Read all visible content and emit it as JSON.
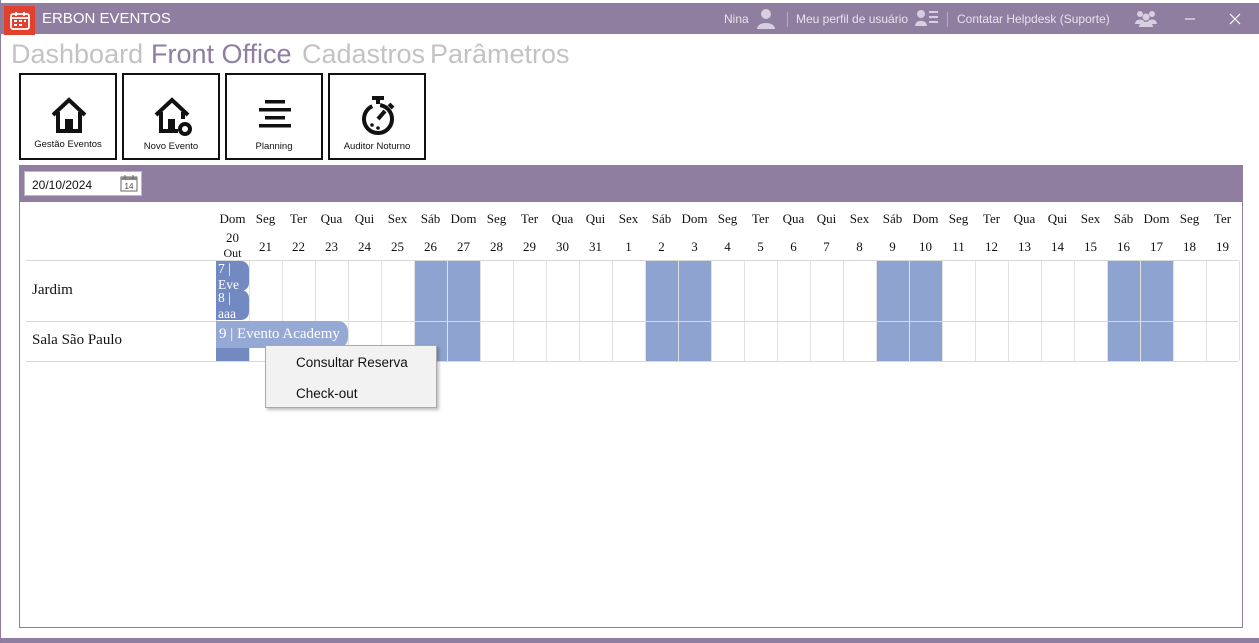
{
  "app": {
    "title": "ERBON EVENTOS"
  },
  "titlebar": {
    "user_name": "Nina",
    "profile_link": "Meu perfil de usuário",
    "helpdesk_link": "Contatar Helpdesk (Suporte)",
    "minimize_label": "—",
    "close_label": "✕"
  },
  "nav": {
    "tabs": [
      {
        "label": "Dashboard",
        "active": false
      },
      {
        "label": "Front Office",
        "active": true
      },
      {
        "label": "Cadastros",
        "active": false
      },
      {
        "label": "Parâmetros",
        "active": false
      }
    ]
  },
  "tiles": [
    {
      "label": "Gestão Eventos",
      "icon": "home-icon"
    },
    {
      "label": "Novo Evento",
      "icon": "home-add-icon"
    },
    {
      "label": "Planning",
      "icon": "align-center-icon"
    },
    {
      "label": "Auditor Noturno",
      "icon": "stopwatch-icon"
    }
  ],
  "toolbar": {
    "date_value": "20/10/2024",
    "calendar_day": "14"
  },
  "planning": {
    "month_label": "Out",
    "days": [
      {
        "dow": "Dom",
        "num": "20"
      },
      {
        "dow": "Seg",
        "num": "21"
      },
      {
        "dow": "Ter",
        "num": "22"
      },
      {
        "dow": "Qua",
        "num": "23"
      },
      {
        "dow": "Qui",
        "num": "24"
      },
      {
        "dow": "Sex",
        "num": "25"
      },
      {
        "dow": "Sáb",
        "num": "26"
      },
      {
        "dow": "Dom",
        "num": "27"
      },
      {
        "dow": "Seg",
        "num": "28"
      },
      {
        "dow": "Ter",
        "num": "29"
      },
      {
        "dow": "Qua",
        "num": "30"
      },
      {
        "dow": "Qui",
        "num": "31"
      },
      {
        "dow": "Sex",
        "num": "1"
      },
      {
        "dow": "Sáb",
        "num": "2"
      },
      {
        "dow": "Dom",
        "num": "3"
      },
      {
        "dow": "Seg",
        "num": "4"
      },
      {
        "dow": "Ter",
        "num": "5"
      },
      {
        "dow": "Qua",
        "num": "6"
      },
      {
        "dow": "Qui",
        "num": "7"
      },
      {
        "dow": "Sex",
        "num": "8"
      },
      {
        "dow": "Sáb",
        "num": "9"
      },
      {
        "dow": "Dom",
        "num": "10"
      },
      {
        "dow": "Seg",
        "num": "11"
      },
      {
        "dow": "Ter",
        "num": "12"
      },
      {
        "dow": "Qua",
        "num": "13"
      },
      {
        "dow": "Qui",
        "num": "14"
      },
      {
        "dow": "Sex",
        "num": "15"
      },
      {
        "dow": "Sáb",
        "num": "16"
      },
      {
        "dow": "Dom",
        "num": "17"
      },
      {
        "dow": "Seg",
        "num": "18"
      },
      {
        "dow": "Ter",
        "num": "19"
      }
    ],
    "rooms": [
      "Jardim",
      "Sala São Paulo"
    ],
    "events": [
      {
        "text": "7 | Eve",
        "room": 0,
        "start_day": 0,
        "length_days": 1
      },
      {
        "text": "8 | aaa",
        "room": 0,
        "start_day": 0,
        "length_days": 1
      },
      {
        "text": "9 | Evento Academy",
        "room": 1,
        "start_day": 0,
        "length_days": 4
      }
    ]
  },
  "context_menu": {
    "items": [
      "Consultar Reserva",
      "Check-out"
    ]
  },
  "colors": {
    "accent": "#8f7ea0",
    "weekend": "#8ea3cf",
    "event": "#7389c1",
    "app_icon": "#e0422f"
  }
}
